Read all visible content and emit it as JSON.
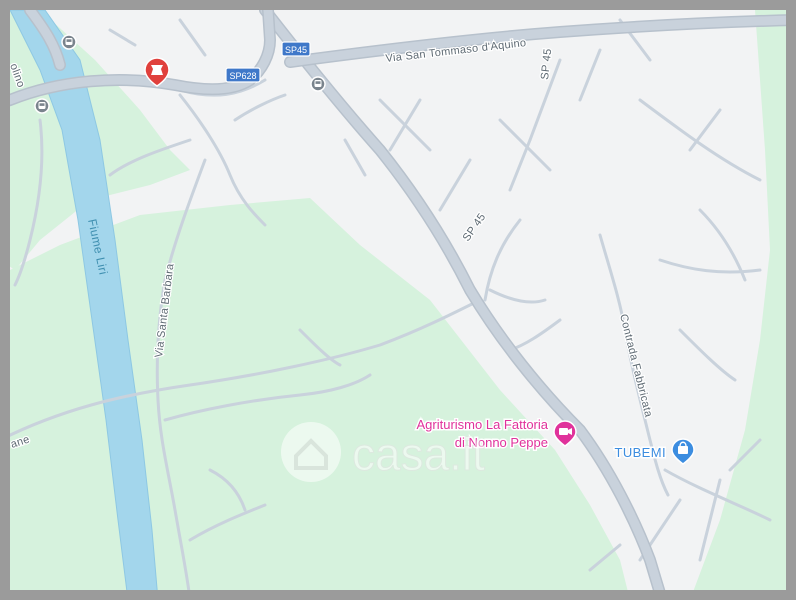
{
  "map": {
    "colors": {
      "land": "#f2f3f4",
      "green": "#d6f2dd",
      "water": "#a3d6ec",
      "water_edge": "#8ec8e3",
      "road": "#c9d2dc",
      "road_edge": "#b7c1cc",
      "road_label": "#5e6a73",
      "water_label": "#3f8fb0",
      "poi_pink": "#e0329b",
      "poi_blue": "#3c8de0",
      "poi_red": "#e0403c",
      "frame": "#9b9b9b"
    },
    "roads": {
      "via_san_tommaso": "Via San Tommaso d'Aquino",
      "sp45_vertical": "SP 45",
      "sp45_diagonal": "SP 45",
      "via_santa_barbara": "Via Santa Barbara",
      "contrada_fabbricata": "Contrada Fabbricata",
      "partial_left_top": "olino",
      "partial_left_bottom": "ane"
    },
    "shields": {
      "sp628": "SP628",
      "sp45": "SP45"
    },
    "water": {
      "river": "Fiume Liri"
    },
    "pois": [
      {
        "name": "Agriturismo La Fattoria\ndi Nonno Peppe",
        "line1": "Agriturismo La Fattoria",
        "line2": "di Nonno Peppe",
        "icon": "camera-icon"
      },
      {
        "name": "TUBEMI",
        "icon": "shopping-bag-icon"
      }
    ],
    "watermark": "casa.it"
  }
}
